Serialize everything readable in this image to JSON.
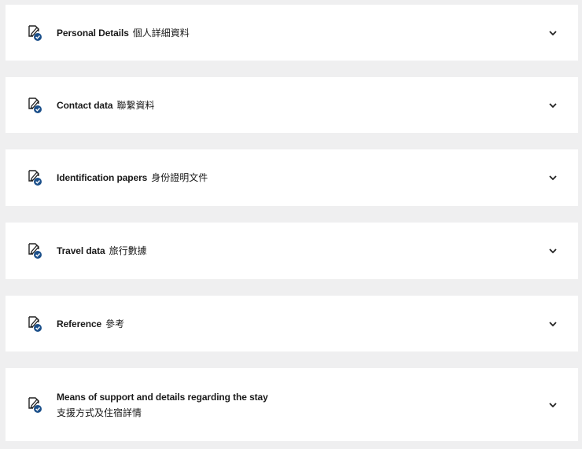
{
  "colors": {
    "page_background": "#efeff0",
    "card_background": "#ffffff",
    "text": "#1a1a1a",
    "check_badge": "#1b4f8a"
  },
  "sections": [
    {
      "title_en": "Personal Details",
      "title_zh": "個人詳細資料",
      "icon": "form-complete-icon",
      "toggle_icon": "chevron-down-icon"
    },
    {
      "title_en": "Contact data",
      "title_zh": "聯繫資料",
      "icon": "form-complete-icon",
      "toggle_icon": "chevron-down-icon"
    },
    {
      "title_en": "Identification papers",
      "title_zh": "身份證明文件",
      "icon": "form-complete-icon",
      "toggle_icon": "chevron-down-icon"
    },
    {
      "title_en": "Travel data",
      "title_zh": "旅行數據",
      "icon": "form-complete-icon",
      "toggle_icon": "chevron-down-icon"
    },
    {
      "title_en": "Reference",
      "title_zh": "參考",
      "icon": "form-complete-icon",
      "toggle_icon": "chevron-down-icon"
    },
    {
      "title_en": "Means of support and details regarding the stay",
      "title_zh": "支援方式及住宿詳情",
      "icon": "form-complete-icon",
      "toggle_icon": "chevron-down-icon"
    }
  ]
}
